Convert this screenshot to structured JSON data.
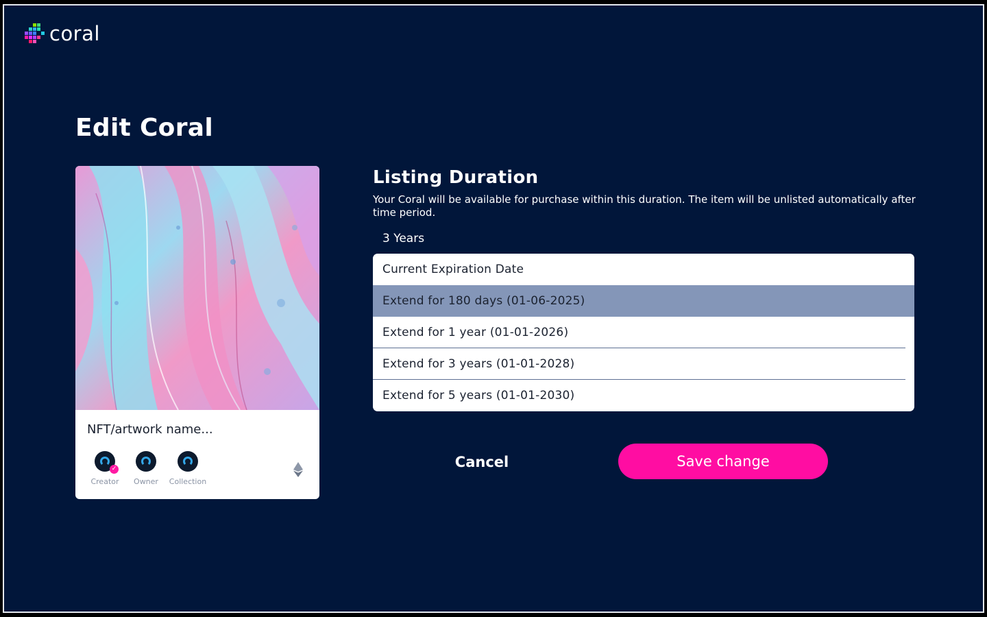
{
  "app": {
    "logo_text": "coral"
  },
  "page": {
    "title": "Edit Coral"
  },
  "card": {
    "name": "NFT/artwork name...",
    "avatars": [
      {
        "label": "Creator",
        "verified": true
      },
      {
        "label": "Owner",
        "verified": false
      },
      {
        "label": "Collection",
        "verified": false
      }
    ],
    "currency_icon": "ethereum-icon"
  },
  "listing": {
    "title": "Listing Duration",
    "description": "Your Coral will be available for purchase within this duration.  The item will be unlisted automatically after time period.",
    "selected_value": "3 Years",
    "options": [
      {
        "label": "Current Expiration Date"
      },
      {
        "label": "Extend for 180 days (01-06-2025)",
        "highlighted": true
      },
      {
        "label": "Extend for 1 year (01-01-2026)"
      },
      {
        "label": "Extend for 3 years (01-01-2028)"
      },
      {
        "label": "Extend for 5 years (01-01-2030)"
      }
    ]
  },
  "actions": {
    "cancel_label": "Cancel",
    "save_label": "Save change"
  },
  "colors": {
    "background": "#01163a",
    "accent": "#ff0da2",
    "highlight": "#8496b8"
  }
}
